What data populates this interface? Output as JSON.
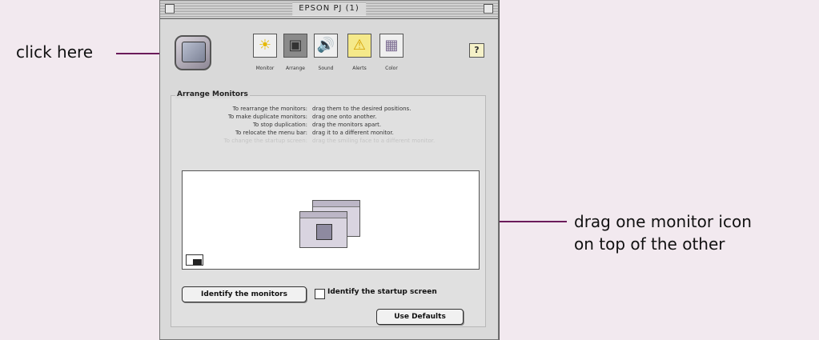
{
  "annotations": {
    "click_here": "click here",
    "drag_line1": "drag one monitor icon",
    "drag_line2": "on top of the other"
  },
  "window": {
    "title": "EPSON PJ (1)"
  },
  "toolbar": {
    "tools": [
      {
        "label": "Monitor",
        "icon": "sun-monitor-icon"
      },
      {
        "label": "Arrange",
        "icon": "arrange-icon",
        "selected": true
      },
      {
        "label": "Sound",
        "icon": "speaker-icon"
      },
      {
        "label": "Alerts",
        "icon": "alert-icon"
      },
      {
        "label": "Color",
        "icon": "color-icon"
      }
    ],
    "help": "?"
  },
  "panel": {
    "title": "Arrange Monitors",
    "instructions": [
      {
        "k": "To rearrange the monitors:",
        "v": "drag them to the desired positions."
      },
      {
        "k": "To make duplicate monitors:",
        "v": "drag one onto another."
      },
      {
        "k": "To stop duplication:",
        "v": "drag the monitors apart."
      },
      {
        "k": "To relocate the menu bar:",
        "v": "drag it to a different monitor."
      },
      {
        "k": "To change the startup screen:",
        "v": "drag the smiling face to a different monitor."
      }
    ],
    "identify_button": "Identify the monitors",
    "startup_checkbox": "Identify the startup screen",
    "defaults_button": "Use Defaults"
  },
  "colors": {
    "background": "#f2e9ef",
    "leader": "#6b1a5a"
  }
}
